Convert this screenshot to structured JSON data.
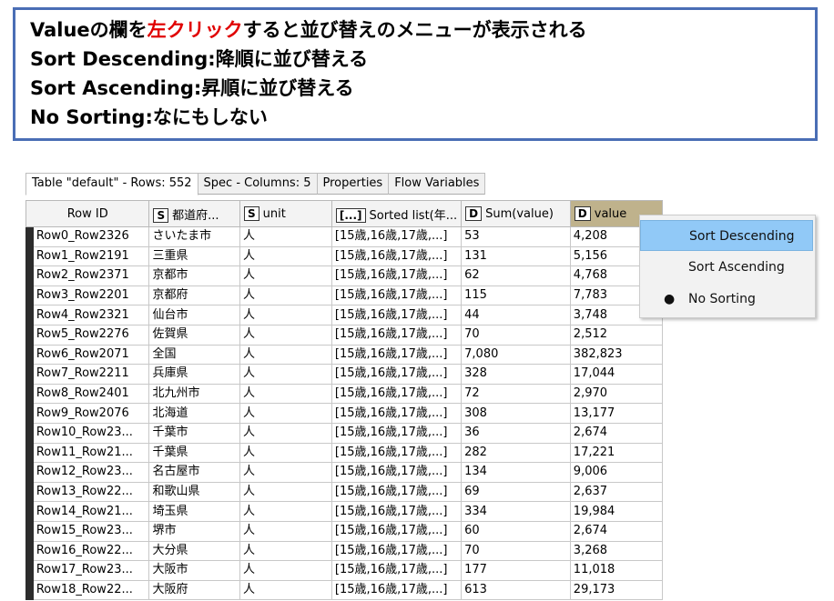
{
  "note": {
    "line1_a": "Valueの欄を",
    "line1_b": "左クリック",
    "line1_c": "すると並び替えのメニューが表示される",
    "line2_a": "Sort Descending",
    "line2_b": ":降順に並び替える",
    "line3_a": "Sort Ascending",
    "line3_b": ":昇順に並び替える",
    "line4_a": "No Sorting",
    "line4_b": ":なにもしない"
  },
  "tabs": [
    "Table \"default\" - Rows: 552",
    "Spec - Columns: 5",
    "Properties",
    "Flow Variables"
  ],
  "columns": {
    "rowid": "Row ID",
    "c1_type": "S",
    "c1": "都道府...",
    "c2_type": "S",
    "c2": "unit",
    "c3_type": "[...]",
    "c3": "Sorted list(年...",
    "c4_type": "D",
    "c4": "Sum(value)",
    "c5_type": "D",
    "c5": "value"
  },
  "rows": [
    [
      "Row0_Row2326",
      "さいたま市",
      "人",
      "[15歳,16歳,17歳,...]",
      "53",
      "4,208"
    ],
    [
      "Row1_Row2191",
      "三重県",
      "人",
      "[15歳,16歳,17歳,...]",
      "131",
      "5,156"
    ],
    [
      "Row2_Row2371",
      "京都市",
      "人",
      "[15歳,16歳,17歳,...]",
      "62",
      "4,768"
    ],
    [
      "Row3_Row2201",
      "京都府",
      "人",
      "[15歳,16歳,17歳,...]",
      "115",
      "7,783"
    ],
    [
      "Row4_Row2321",
      "仙台市",
      "人",
      "[15歳,16歳,17歳,...]",
      "44",
      "3,748"
    ],
    [
      "Row5_Row2276",
      "佐賀県",
      "人",
      "[15歳,16歳,17歳,...]",
      "70",
      "2,512"
    ],
    [
      "Row6_Row2071",
      "全国",
      "人",
      "[15歳,16歳,17歳,...]",
      "7,080",
      "382,823"
    ],
    [
      "Row7_Row2211",
      "兵庫県",
      "人",
      "[15歳,16歳,17歳,...]",
      "328",
      "17,044"
    ],
    [
      "Row8_Row2401",
      "北九州市",
      "人",
      "[15歳,16歳,17歳,...]",
      "72",
      "2,970"
    ],
    [
      "Row9_Row2076",
      "北海道",
      "人",
      "[15歳,16歳,17歳,...]",
      "308",
      "13,177"
    ],
    [
      "Row10_Row23...",
      "千葉市",
      "人",
      "[15歳,16歳,17歳,...]",
      "36",
      "2,674"
    ],
    [
      "Row11_Row21...",
      "千葉県",
      "人",
      "[15歳,16歳,17歳,...]",
      "282",
      "17,221"
    ],
    [
      "Row12_Row23...",
      "名古屋市",
      "人",
      "[15歳,16歳,17歳,...]",
      "134",
      "9,006"
    ],
    [
      "Row13_Row22...",
      "和歌山県",
      "人",
      "[15歳,16歳,17歳,...]",
      "69",
      "2,637"
    ],
    [
      "Row14_Row21...",
      "埼玉県",
      "人",
      "[15歳,16歳,17歳,...]",
      "334",
      "19,984"
    ],
    [
      "Row15_Row23...",
      "堺市",
      "人",
      "[15歳,16歳,17歳,...]",
      "60",
      "2,674"
    ],
    [
      "Row16_Row22...",
      "大分県",
      "人",
      "[15歳,16歳,17歳,...]",
      "70",
      "3,268"
    ],
    [
      "Row17_Row23...",
      "大阪市",
      "人",
      "[15歳,16歳,17歳,...]",
      "177",
      "11,018"
    ],
    [
      "Row18_Row22...",
      "大阪府",
      "人",
      "[15歳,16歳,17歳,...]",
      "613",
      "29,173"
    ]
  ],
  "menu": {
    "items": [
      "Sort Descending",
      "Sort Ascending",
      "No Sorting"
    ],
    "selected_marker": "●"
  },
  "colors": {
    "note_border": "#4a6eb5",
    "highlight_text": "#e00000",
    "value_header": "#bfb28c",
    "menu_highlight": "#91c9f7"
  }
}
